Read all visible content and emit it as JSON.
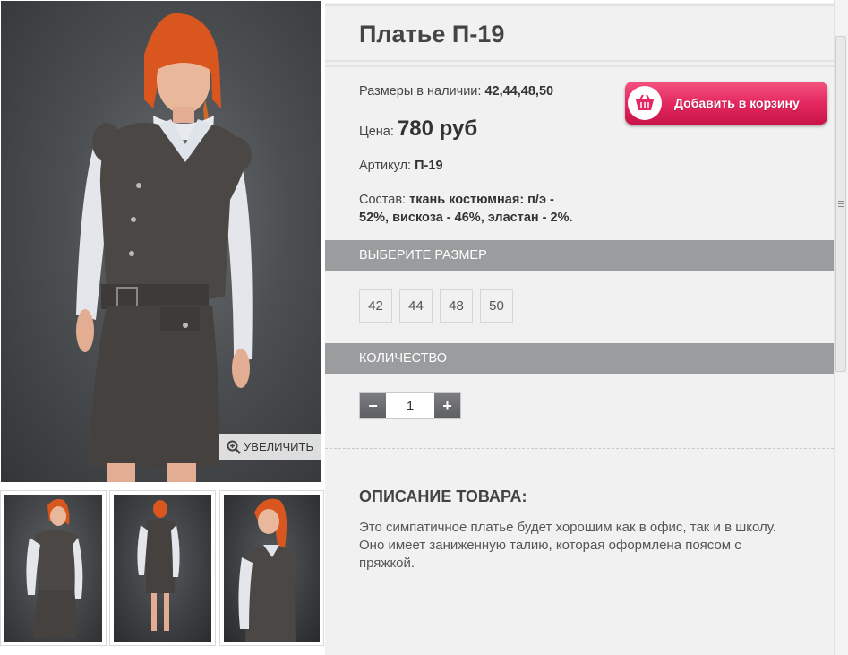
{
  "product": {
    "title": "Платье П-19",
    "sizes_available_label": "Размеры в наличии:",
    "sizes_available_value": "42,44,48,50",
    "price_label": "Цена:",
    "price_value": "780 руб",
    "article_label": "Артикул:",
    "article_value": "П-19",
    "composition_label": "Состав:",
    "composition_value_line1": "ткань костюмная: п/э -",
    "composition_value_line2": "52%, вискоза - 46%, эластан - 2%."
  },
  "gallery": {
    "zoom_label": "УВЕЛИЧИТЬ",
    "zoom_icon": "magnifier-plus-icon"
  },
  "cart_button": {
    "label": "Добавить в корзину",
    "icon": "basket-icon"
  },
  "size_section": {
    "header": "ВЫБЕРИТЕ РАЗМЕР",
    "options": [
      "42",
      "44",
      "48",
      "50"
    ]
  },
  "quantity_section": {
    "header": "КОЛИЧЕСТВО",
    "minus": "−",
    "plus": "+",
    "value": "1"
  },
  "description": {
    "title": "ОПИСАНИЕ ТОВАРА:",
    "text": "Это симпатичное платье будет хорошим как в офис, так и в школу. Оно имеет заниженную талию, которая оформлена поясом с пряжкой."
  },
  "colors": {
    "accent": "#e42861",
    "section_bar": "#9a9c9e",
    "panel_bg": "#f1f1f1"
  }
}
